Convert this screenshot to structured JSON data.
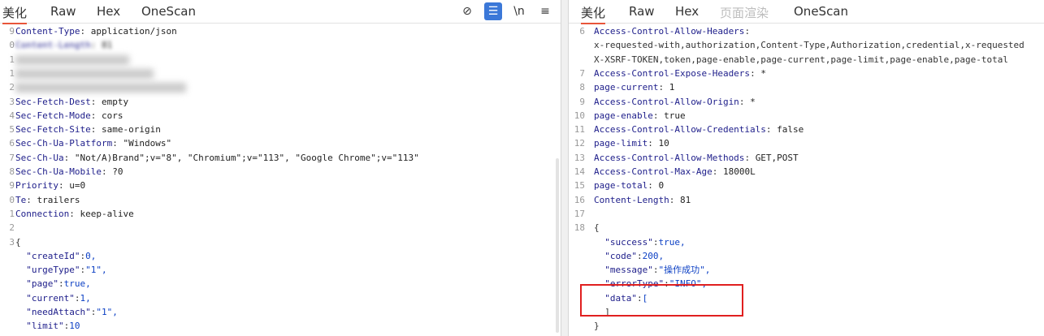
{
  "left": {
    "tabs": [
      "美化",
      "Raw",
      "Hex",
      "OneScan"
    ],
    "icons": [
      "eye-off-icon",
      "list-icon",
      "newline-icon",
      "menu-icon"
    ],
    "icon_glyphs": [
      "⊘",
      "☰",
      "\\n",
      "≡"
    ],
    "lines": [
      {
        "n": "9",
        "k": "Content-Type",
        "sep": ": ",
        "v": "application/json"
      },
      {
        "n": "0",
        "k": "Content-Length",
        "sep": ": ",
        "v": "81",
        "blurred": true
      },
      {
        "n": "1",
        "blurred": true
      },
      {
        "n": "1",
        "blurred": true
      },
      {
        "n": "2",
        "blurred": true
      },
      {
        "n": "3",
        "k": "Sec-Fetch-Dest",
        "sep": ": ",
        "v": "empty"
      },
      {
        "n": "4",
        "k": "Sec-Fetch-Mode",
        "sep": ": ",
        "v": "cors"
      },
      {
        "n": "5",
        "k": "Sec-Fetch-Site",
        "sep": ": ",
        "v": "same-origin"
      },
      {
        "n": "6",
        "k": "Sec-Ch-Ua-Platform",
        "sep": ": ",
        "v": "\"Windows\""
      },
      {
        "n": "7",
        "k": "Sec-Ch-Ua",
        "sep": ": ",
        "v": "\"Not/A)Brand\";v=\"8\", \"Chromium\";v=\"113\", \"Google Chrome\";v=\"113\""
      },
      {
        "n": "8",
        "k": "Sec-Ch-Ua-Mobile",
        "sep": ": ",
        "v": "?0"
      },
      {
        "n": "9",
        "k": "Priority",
        "sep": ": ",
        "v": "u=0"
      },
      {
        "n": "0",
        "k": "Te",
        "sep": ": ",
        "v": "trailers"
      },
      {
        "n": "1",
        "k": "Connection",
        "sep": ": ",
        "v": "keep-alive"
      },
      {
        "n": "2",
        "t": ""
      },
      {
        "n": "3",
        "t": "{"
      },
      {
        "n": "",
        "indent": "  ",
        "k": "\"createId\"",
        "sep": ":",
        "v": "0,"
      },
      {
        "n": "",
        "indent": "  ",
        "k": "\"urgeType\"",
        "sep": ":",
        "v": "\"1\","
      },
      {
        "n": "",
        "indent": "  ",
        "k": "\"page\"",
        "sep": ":",
        "v": "true,"
      },
      {
        "n": "",
        "indent": "  ",
        "k": "\"current\"",
        "sep": ":",
        "v": "1,"
      },
      {
        "n": "",
        "indent": "  ",
        "k": "\"needAttach\"",
        "sep": ":",
        "v": "\"1\","
      },
      {
        "n": "",
        "indent": "  ",
        "k": "\"limit\"",
        "sep": ":",
        "v": "10"
      },
      {
        "n": "",
        "t": "}"
      }
    ]
  },
  "right": {
    "tabs": [
      "美化",
      "Raw",
      "Hex",
      "页面渲染",
      "OneScan"
    ],
    "lines": [
      {
        "n": "6",
        "k": "Access-Control-Allow-Headers",
        "sep": ":",
        "v": ""
      },
      {
        "n": "",
        "t": "x-requested-with,authorization,Content-Type,Authorization,credential,x-requested"
      },
      {
        "n": "",
        "t": "X-XSRF-TOKEN,token,page-enable,page-current,page-limit,page-enable,page-total"
      },
      {
        "n": "7",
        "k": "Access-Control-Expose-Headers",
        "sep": ": ",
        "v": "*"
      },
      {
        "n": "8",
        "k": "page-current",
        "sep": ": ",
        "v": "1"
      },
      {
        "n": "9",
        "k": "Access-Control-Allow-Origin",
        "sep": ": ",
        "v": "*"
      },
      {
        "n": "10",
        "k": "page-enable",
        "sep": ": ",
        "v": "true"
      },
      {
        "n": "11",
        "k": "Access-Control-Allow-Credentials",
        "sep": ": ",
        "v": "false"
      },
      {
        "n": "12",
        "k": "page-limit",
        "sep": ": ",
        "v": "10"
      },
      {
        "n": "13",
        "k": "Access-Control-Allow-Methods",
        "sep": ": ",
        "v": "GET,POST"
      },
      {
        "n": "14",
        "k": "Access-Control-Max-Age",
        "sep": ": ",
        "v": "18000L"
      },
      {
        "n": "15",
        "k": "page-total",
        "sep": ": ",
        "v": "0"
      },
      {
        "n": "16",
        "k": "Content-Length",
        "sep": ": ",
        "v": "81"
      },
      {
        "n": "17",
        "t": ""
      },
      {
        "n": "18",
        "t": "{"
      },
      {
        "n": "",
        "indent": "  ",
        "k": "\"success\"",
        "sep": ":",
        "v": "true,"
      },
      {
        "n": "",
        "indent": "  ",
        "k": "\"code\"",
        "sep": ":",
        "v": "200,"
      },
      {
        "n": "",
        "indent": "  ",
        "k": "\"message\"",
        "sep": ":",
        "v": "\"操作成功\","
      },
      {
        "n": "",
        "indent": "  ",
        "k": "\"errorType\"",
        "sep": ":",
        "v": "\"INFO\","
      },
      {
        "n": "",
        "indent": "  ",
        "k": "\"data\"",
        "sep": ":",
        "v": "["
      },
      {
        "n": "",
        "t": "  ]"
      },
      {
        "n": "",
        "t": "}"
      }
    ]
  },
  "highlight_color": "#e02020",
  "active_tab_color": "#e8553a",
  "active_icon_color": "#3b78d8"
}
